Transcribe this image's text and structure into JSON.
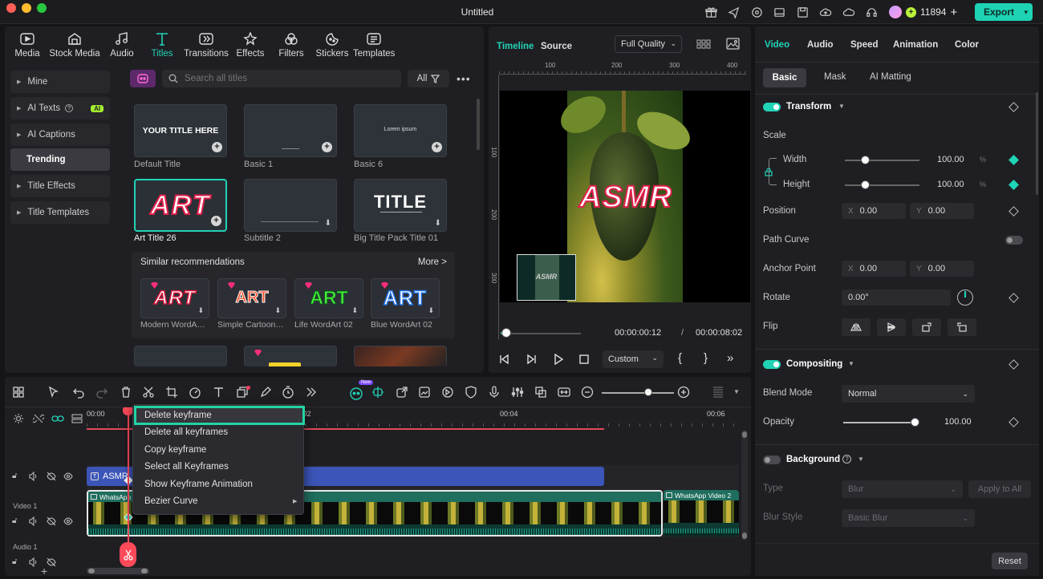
{
  "window": {
    "title": "Untitled"
  },
  "topbar": {
    "credits": "11894",
    "export_label": "Export"
  },
  "media_tabs": [
    "Media",
    "Stock Media",
    "Audio",
    "Titles",
    "Transitions",
    "Effects",
    "Filters",
    "Stickers",
    "Templates"
  ],
  "sidebar": {
    "items": [
      {
        "label": "Mine"
      },
      {
        "label": "AI Texts",
        "badge": "AI"
      },
      {
        "label": "AI Captions"
      },
      {
        "label": "Trending"
      },
      {
        "label": "Title Effects"
      },
      {
        "label": "Title Templates"
      }
    ]
  },
  "search": {
    "placeholder": "Search all titles",
    "filter_label": "All"
  },
  "titles_grid": [
    {
      "label": "Default Title",
      "thumb": "YOUR TITLE HERE"
    },
    {
      "label": "Basic 1",
      "thumb": ""
    },
    {
      "label": "Basic 6",
      "thumb": "Lorem ipsum"
    },
    {
      "label": "Art Title 26",
      "thumb": "ART"
    },
    {
      "label": "Subtitle 2",
      "thumb": ""
    },
    {
      "label": "Big Title Pack Title 01",
      "thumb": "TITLE"
    }
  ],
  "recommendations": {
    "heading": "Similar recommendations",
    "more_label": "More >",
    "items": [
      {
        "label": "Modern WordA…",
        "thumb": "ART"
      },
      {
        "label": "Simple Cartoon…",
        "thumb": "ART"
      },
      {
        "label": "Life WordArt 02",
        "thumb": "ART"
      },
      {
        "label": "Blue WordArt 02",
        "thumb": "ART"
      }
    ]
  },
  "preview": {
    "tabs": [
      "Timeline",
      "Source"
    ],
    "quality": "Full Quality",
    "ruler": [
      "100",
      "200",
      "300",
      "400"
    ],
    "vruler": [
      "100",
      "200",
      "300"
    ],
    "overlay_text": "ASMR",
    "current_time": "00:00:00:12",
    "separator": "/",
    "total_time": "00:00:08:02",
    "zoom_label": "Custom"
  },
  "props": {
    "tabs": [
      "Video",
      "Audio",
      "Speed",
      "Animation",
      "Color"
    ],
    "subtabs": [
      "Basic",
      "Mask",
      "AI Matting"
    ],
    "transform_label": "Transform",
    "scale_label": "Scale",
    "width_label": "Width",
    "width_value": "100.00",
    "height_label": "Height",
    "height_value": "100.00",
    "unit": "%",
    "position_label": "Position",
    "pos_x": "0.00",
    "pos_y": "0.00",
    "path_curve_label": "Path Curve",
    "anchor_label": "Anchor Point",
    "anchor_x": "0.00",
    "anchor_y": "0.00",
    "rotate_label": "Rotate",
    "rotate_value": "0.00°",
    "flip_label": "Flip",
    "compositing_label": "Compositing",
    "blend_label": "Blend Mode",
    "blend_value": "Normal",
    "opacity_label": "Opacity",
    "opacity_value": "100.00",
    "background_label": "Background",
    "type_label": "Type",
    "type_value": "Blur",
    "apply_all_label": "Apply to All",
    "blur_style_label": "Blur Style",
    "blur_style_value": "Basic Blur",
    "reset_label": "Reset",
    "x_prefix": "X",
    "y_prefix": "Y"
  },
  "timeline": {
    "ruler": [
      "00:00",
      "00:02",
      "00:04",
      "00:06"
    ],
    "title_clip": "ASMR",
    "video_clip": "WhatsApp",
    "video_clip2": "WhatsApp Video 2",
    "track_video": "Video 1",
    "track_audio": "Audio 1",
    "new_badge": "New"
  },
  "context_menu": [
    "Delete keyframe",
    "Delete all keyframes",
    "Copy keyframe",
    "Select all Keyframes",
    "Show Keyframe Animation",
    "Bezier Curve"
  ],
  "colors": {
    "accent": "#21d3b6",
    "title_clip": "#3c55b8",
    "video_clip": "#1f6e5e",
    "playhead": "#ff4a5a"
  }
}
